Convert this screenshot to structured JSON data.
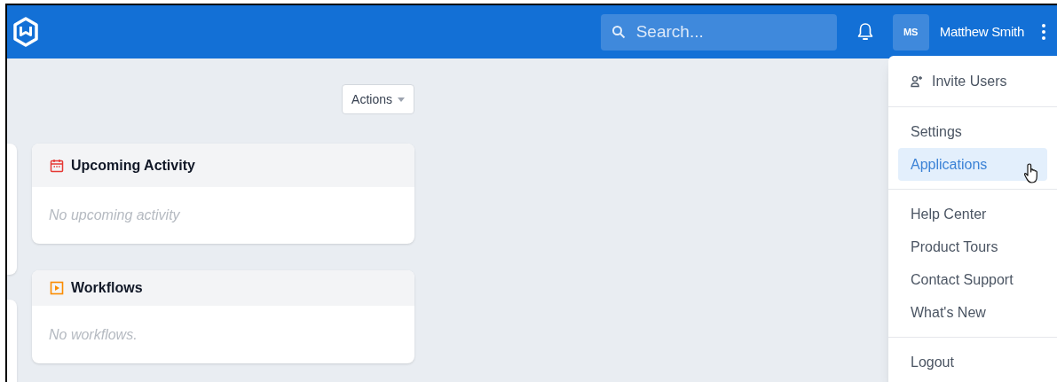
{
  "header": {
    "search": {
      "placeholder": "Search..."
    },
    "user": {
      "initials": "MS",
      "name": "Matthew Smith"
    }
  },
  "toolbar": {
    "actions_button": "Actions"
  },
  "cards": [
    {
      "title": "Upcoming Activity",
      "kind": "calendar",
      "empty_text": "No upcoming activity"
    },
    {
      "title": "Workflows",
      "kind": "workflow",
      "empty_text": "No workflows."
    }
  ],
  "user_menu": {
    "groups": [
      [
        {
          "label": "Invite Users",
          "kind": "invite",
          "selected": false
        }
      ],
      [
        {
          "label": "Settings",
          "selected": false
        },
        {
          "label": "Applications",
          "selected": true
        }
      ],
      [
        {
          "label": "Help Center",
          "selected": false
        },
        {
          "label": "Product Tours",
          "selected": false
        },
        {
          "label": "Contact Support",
          "selected": false
        },
        {
          "label": "What's New",
          "selected": false
        }
      ],
      [
        {
          "label": "Logout",
          "selected": false
        }
      ]
    ]
  }
}
